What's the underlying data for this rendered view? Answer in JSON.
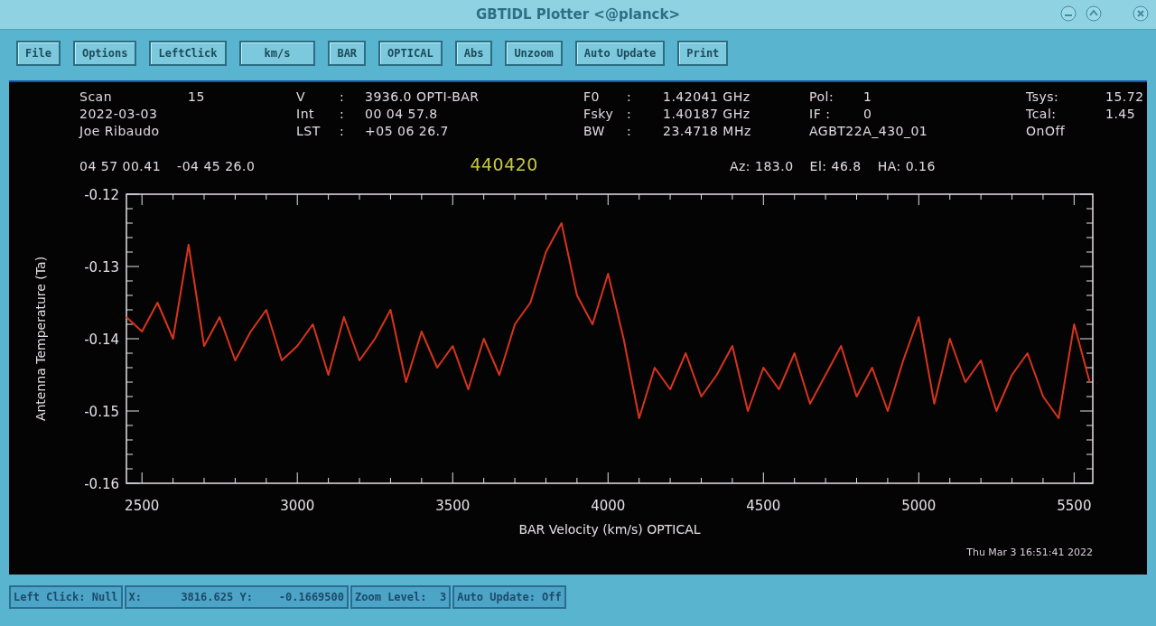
{
  "window": {
    "title": "GBTIDL Plotter <@planck>"
  },
  "toolbar": [
    {
      "label": "File"
    },
    {
      "label": "Options"
    },
    {
      "label": "LeftClick"
    },
    {
      "label": "km/s"
    },
    {
      "label": "BAR"
    },
    {
      "label": "OPTICAL"
    },
    {
      "label": "Abs"
    },
    {
      "label": "Unzoom"
    },
    {
      "label": "Auto Update"
    },
    {
      "label": "Print"
    }
  ],
  "header": {
    "groups": [
      {
        "lines": [
          [
            "Scan",
            "15"
          ],
          [
            "2022-03-03"
          ],
          [
            "Joe Ribaudo"
          ]
        ]
      },
      {
        "lines": [
          [
            "V",
            ":",
            "3936.0 OPTI-BAR"
          ],
          [
            "Int",
            ":",
            "00 04 57.8"
          ],
          [
            "LST",
            ":",
            "+05 06 26.7"
          ]
        ]
      },
      {
        "lines": [
          [
            "F0",
            ":",
            "1.42041 GHz"
          ],
          [
            "Fsky",
            ":",
            "1.40187 GHz"
          ],
          [
            "BW",
            ":",
            "23.4718 MHz"
          ]
        ]
      },
      {
        "lines": [
          [
            "Pol:",
            "1"
          ],
          [
            "IF :",
            "0"
          ],
          [
            "AGBT22A_430_01"
          ]
        ]
      },
      {
        "lines": [
          [
            "Tsys:",
            "15.72"
          ],
          [
            "Tcal:",
            "1.45"
          ],
          [
            "OnOff"
          ]
        ]
      }
    ],
    "ra": "04 57 00.41",
    "dec": "-04 45 26.0",
    "source": "440420",
    "az": "Az: 183.0",
    "el": "El:  46.8",
    "ha": "HA:  0.16"
  },
  "plot": {
    "chart_data": {
      "type": "line",
      "xlabel": "BAR Velocity (km/s) OPTICAL",
      "ylabel": "Antenna Temperature (Ta)",
      "x": [
        2450,
        2500,
        2550,
        2600,
        2650,
        2700,
        2750,
        2800,
        2850,
        2900,
        2950,
        3000,
        3050,
        3100,
        3150,
        3200,
        3250,
        3300,
        3350,
        3400,
        3450,
        3500,
        3550,
        3600,
        3650,
        3700,
        3750,
        3800,
        3850,
        3900,
        3950,
        4000,
        4050,
        4100,
        4150,
        4200,
        4250,
        4300,
        4350,
        4400,
        4450,
        4500,
        4550,
        4600,
        4650,
        4700,
        4750,
        4800,
        4850,
        4900,
        4950,
        5000,
        5050,
        5100,
        5150,
        5200,
        5250,
        5300,
        5350,
        5400,
        5450,
        5500,
        5550
      ],
      "series": [
        {
          "color": "#d8341c",
          "values": [
            -0.137,
            -0.139,
            -0.135,
            -0.14,
            -0.127,
            -0.141,
            -0.137,
            -0.143,
            -0.139,
            -0.136,
            -0.143,
            -0.141,
            -0.138,
            -0.145,
            -0.137,
            -0.143,
            -0.14,
            -0.136,
            -0.146,
            -0.139,
            -0.144,
            -0.141,
            -0.147,
            -0.14,
            -0.145,
            -0.138,
            -0.135,
            -0.128,
            -0.124,
            -0.134,
            -0.138,
            -0.131,
            -0.14,
            -0.151,
            -0.144,
            -0.147,
            -0.142,
            -0.148,
            -0.145,
            -0.141,
            -0.15,
            -0.144,
            -0.147,
            -0.142,
            -0.149,
            -0.145,
            -0.141,
            -0.148,
            -0.144,
            -0.15,
            -0.143,
            -0.137,
            -0.149,
            -0.14,
            -0.146,
            -0.143,
            -0.15,
            -0.145,
            -0.142,
            -0.148,
            -0.151,
            -0.138,
            -0.146
          ]
        }
      ],
      "xlim": [
        2450,
        5560
      ],
      "ylim": [
        -0.16,
        -0.12
      ],
      "xticks": [
        2500,
        3000,
        3500,
        4000,
        4500,
        5000,
        5500
      ],
      "yticks": [
        {
          "value": -0.16,
          "label": "-0.16"
        },
        {
          "value": -0.15,
          "label": "-0.15"
        },
        {
          "value": -0.14,
          "label": "-0.14"
        },
        {
          "value": -0.13,
          "label": "-0.13"
        },
        {
          "value": -0.12,
          "label": "-0.12"
        }
      ]
    },
    "timestamp": "Thu Mar  3 16:51:41 2022"
  },
  "status_bar": [
    "Left Click: Null",
    "X:      3816.625 Y:    -0.1669500",
    "Zoom Level:  3",
    "Auto Update: Off"
  ]
}
